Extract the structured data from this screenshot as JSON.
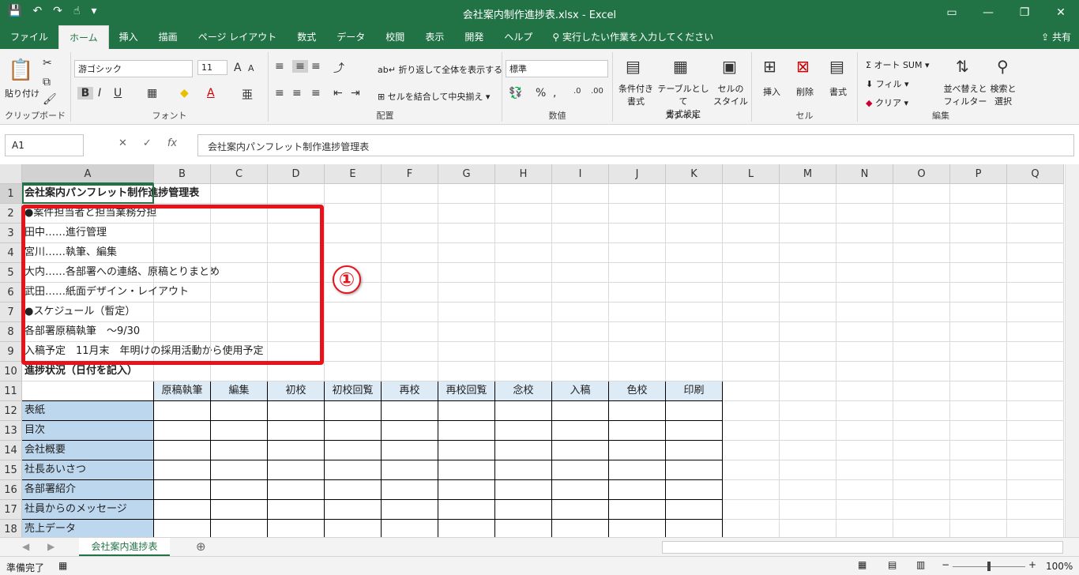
{
  "window": {
    "title": "会社案内制作進捗表.xlsx  -  Excel"
  },
  "tabs": [
    "ファイル",
    "ホーム",
    "挿入",
    "描画",
    "ページ レイアウト",
    "数式",
    "データ",
    "校閲",
    "表示",
    "開発",
    "ヘルプ"
  ],
  "active_tab": "ホーム",
  "tellme": "実行したい作業を入力してください",
  "share": "共有",
  "ribbon": {
    "clipboard": {
      "paste": "貼り付け",
      "label": "クリップボード"
    },
    "font": {
      "name": "游ゴシック",
      "size": "11",
      "label": "フォント"
    },
    "alignment": {
      "wrap": "折り返して全体を表示する",
      "merge": "セルを結合して中央揃え",
      "label": "配置"
    },
    "number": {
      "format": "標準",
      "label": "数値"
    },
    "styles": {
      "conditional": "条件付き\n書式",
      "table": "テーブルとして\n書式設定",
      "cellstyle": "セルの\nスタイル",
      "label": "スタイル"
    },
    "cells": {
      "insert": "挿入",
      "delete": "削除",
      "format": "書式",
      "label": "セル"
    },
    "editing": {
      "autosum": "オート SUM",
      "fill": "フィル",
      "clear": "クリア",
      "sort": "並べ替えと\nフィルター",
      "find": "検索と\n選択",
      "label": "編集"
    }
  },
  "formula_bar": {
    "name_box": "A1",
    "content": "会社案内パンフレット制作進捗管理表"
  },
  "columns": [
    "A",
    "B",
    "C",
    "D",
    "E",
    "F",
    "G",
    "H",
    "I",
    "J",
    "K",
    "L",
    "M",
    "N",
    "O",
    "P",
    "Q"
  ],
  "rows": [
    "1",
    "2",
    "3",
    "4",
    "5",
    "6",
    "7",
    "8",
    "9",
    "10",
    "11",
    "12",
    "13",
    "14",
    "15",
    "16",
    "17",
    "18"
  ],
  "cells": {
    "a1": "会社案内パンフレット制作進捗管理表",
    "a2": "●案件担当者と担当業務分担",
    "a3": "田中……進行管理",
    "a4": "宮川……執筆、編集",
    "a5": "大内……各部署への連絡、原稿とりまとめ",
    "a6": "武田……紙面デザイン・レイアウト",
    "a7": "●スケジュール（暫定）",
    "a8": "各部署原稿執筆　～9/30",
    "a9": "入稿予定　11月末　年明けの採用活動から使用予定",
    "a10": "進捗状況（日付を記入）"
  },
  "table_header": [
    "原稿執筆",
    "編集",
    "初校",
    "初校回覧",
    "再校",
    "再校回覧",
    "念校",
    "入稿",
    "色校",
    "印刷"
  ],
  "table_rows": [
    "表紙",
    "目次",
    "会社概要",
    "社長あいさつ",
    "各部署紹介",
    "社員からのメッセージ",
    "売上データ"
  ],
  "callout": "①",
  "sheet_tab": "会社案内進捗表",
  "status": {
    "ready": "準備完了",
    "zoom": "100%"
  }
}
